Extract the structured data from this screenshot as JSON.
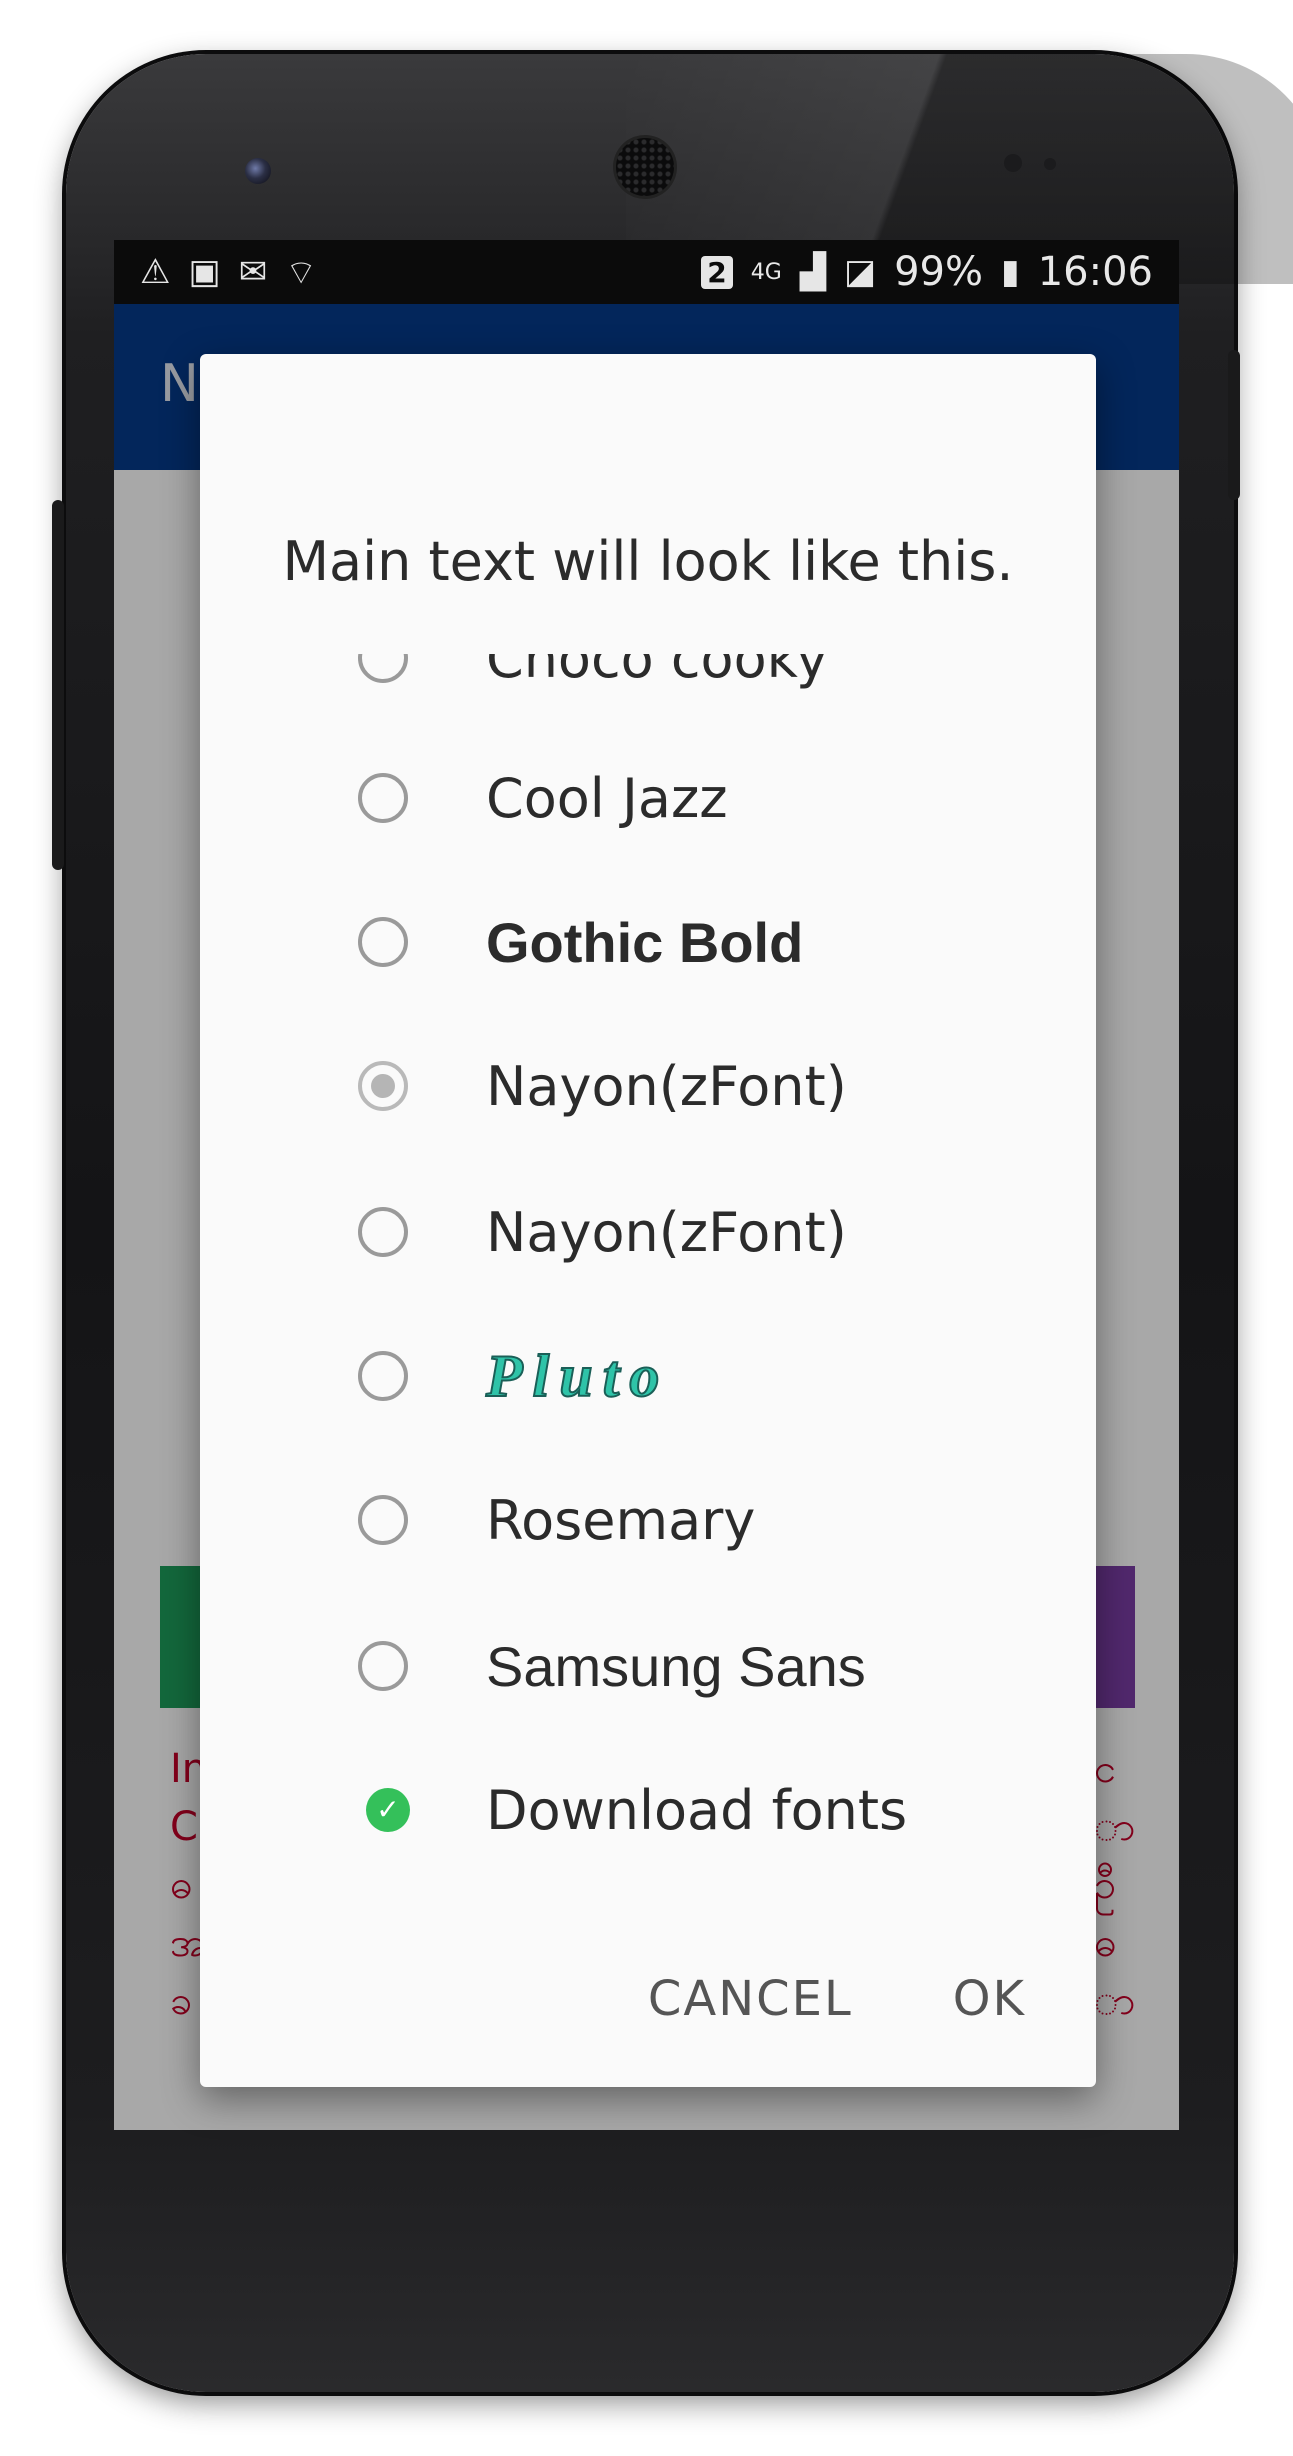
{
  "status_bar": {
    "left_icons": [
      "warning-icon",
      "image-icon",
      "mail-icon",
      "wifi-icon"
    ],
    "sim_badge": "2",
    "network": "4G",
    "battery": "99%",
    "time": "16:06"
  },
  "app_bar": {
    "title": "N"
  },
  "background": {
    "left_lines": [
      "In",
      "C",
      "ဓ",
      "အ",
      "ခ"
    ],
    "right_lines": [
      "င",
      "ာ",
      "ဦ",
      "ဓ",
      "ာ"
    ]
  },
  "dialog": {
    "preview_text": "Main text will look like this.",
    "options": [
      {
        "label": "Choco cooky",
        "selected": false,
        "partial": true
      },
      {
        "label": "Cool Jazz",
        "selected": false
      },
      {
        "label": "Gothic Bold",
        "selected": false
      },
      {
        "label": "Nayon(zFont)",
        "selected": true
      },
      {
        "label": "Nayon(zFont)",
        "selected": false
      },
      {
        "label": "Pluto",
        "selected": false
      },
      {
        "label": "Rosemary",
        "selected": false
      },
      {
        "label": "Samsung Sans",
        "selected": false
      },
      {
        "label": "Download fonts",
        "selected": false,
        "download": true
      }
    ],
    "cancel_label": "CANCEL",
    "ok_label": "OK"
  }
}
